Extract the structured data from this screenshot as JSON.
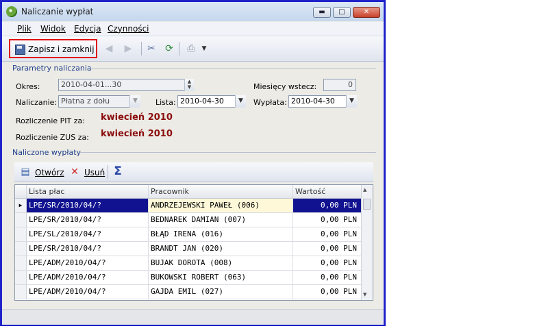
{
  "window": {
    "title": "Naliczanie wypłat"
  },
  "menu": [
    "Plik",
    "Widok",
    "Edycja",
    "Czynności"
  ],
  "toolbar": {
    "save_label": "Zapisz i zamknij"
  },
  "params": {
    "section_title": "Parametry naliczania",
    "okres_label": "Okres:",
    "okres_value": "2010-04-01...30",
    "naliczanie_label": "Naliczanie:",
    "naliczanie_value": "Płatna z dołu",
    "lista_label": "Lista:",
    "lista_value": "2010-04-30",
    "miesiecy_label": "Miesięcy wstecz:",
    "miesiecy_value": "0",
    "wyplata_label": "Wypłata:",
    "wyplata_value": "2010-04-30",
    "pit_label": "Rozliczenie PIT za:",
    "pit_value": "kwiecień 2010",
    "zus_label": "Rozliczenie ZUS za:",
    "zus_value": "kwiecień 2010"
  },
  "list": {
    "section_title": "Naliczone wypłaty",
    "open_label": "Otwórz",
    "delete_label": "Usuń",
    "columns": [
      "Lista płac",
      "Pracownik",
      "Wartość"
    ],
    "rows": [
      [
        "LPE/SR/2010/04/?",
        "ANDRZEJEWSKI PAWEŁ (006)",
        "0,00 PLN"
      ],
      [
        "LPE/SR/2010/04/?",
        "BEDNAREK DAMIAN (007)",
        "0,00 PLN"
      ],
      [
        "LPE/SL/2010/04/?",
        "BŁĄD IRENA (016)",
        "0,00 PLN"
      ],
      [
        "LPE/SR/2010/04/?",
        "BRANDT JAN (020)",
        "0,00 PLN"
      ],
      [
        "LPE/ADM/2010/04/?",
        "BUJAK DOROTA (008)",
        "0,00 PLN"
      ],
      [
        "LPE/ADM/2010/04/?",
        "BUKOWSKI ROBERT (063)",
        "0,00 PLN"
      ],
      [
        "LPE/ADM/2010/04/?",
        "GAJDA EMIL (027)",
        "0,00 PLN"
      ]
    ]
  },
  "colors": {
    "selection": "#10128f",
    "highlight": "#fff8d8",
    "month": "#8b0d0d",
    "frame": "#1f22c9"
  }
}
